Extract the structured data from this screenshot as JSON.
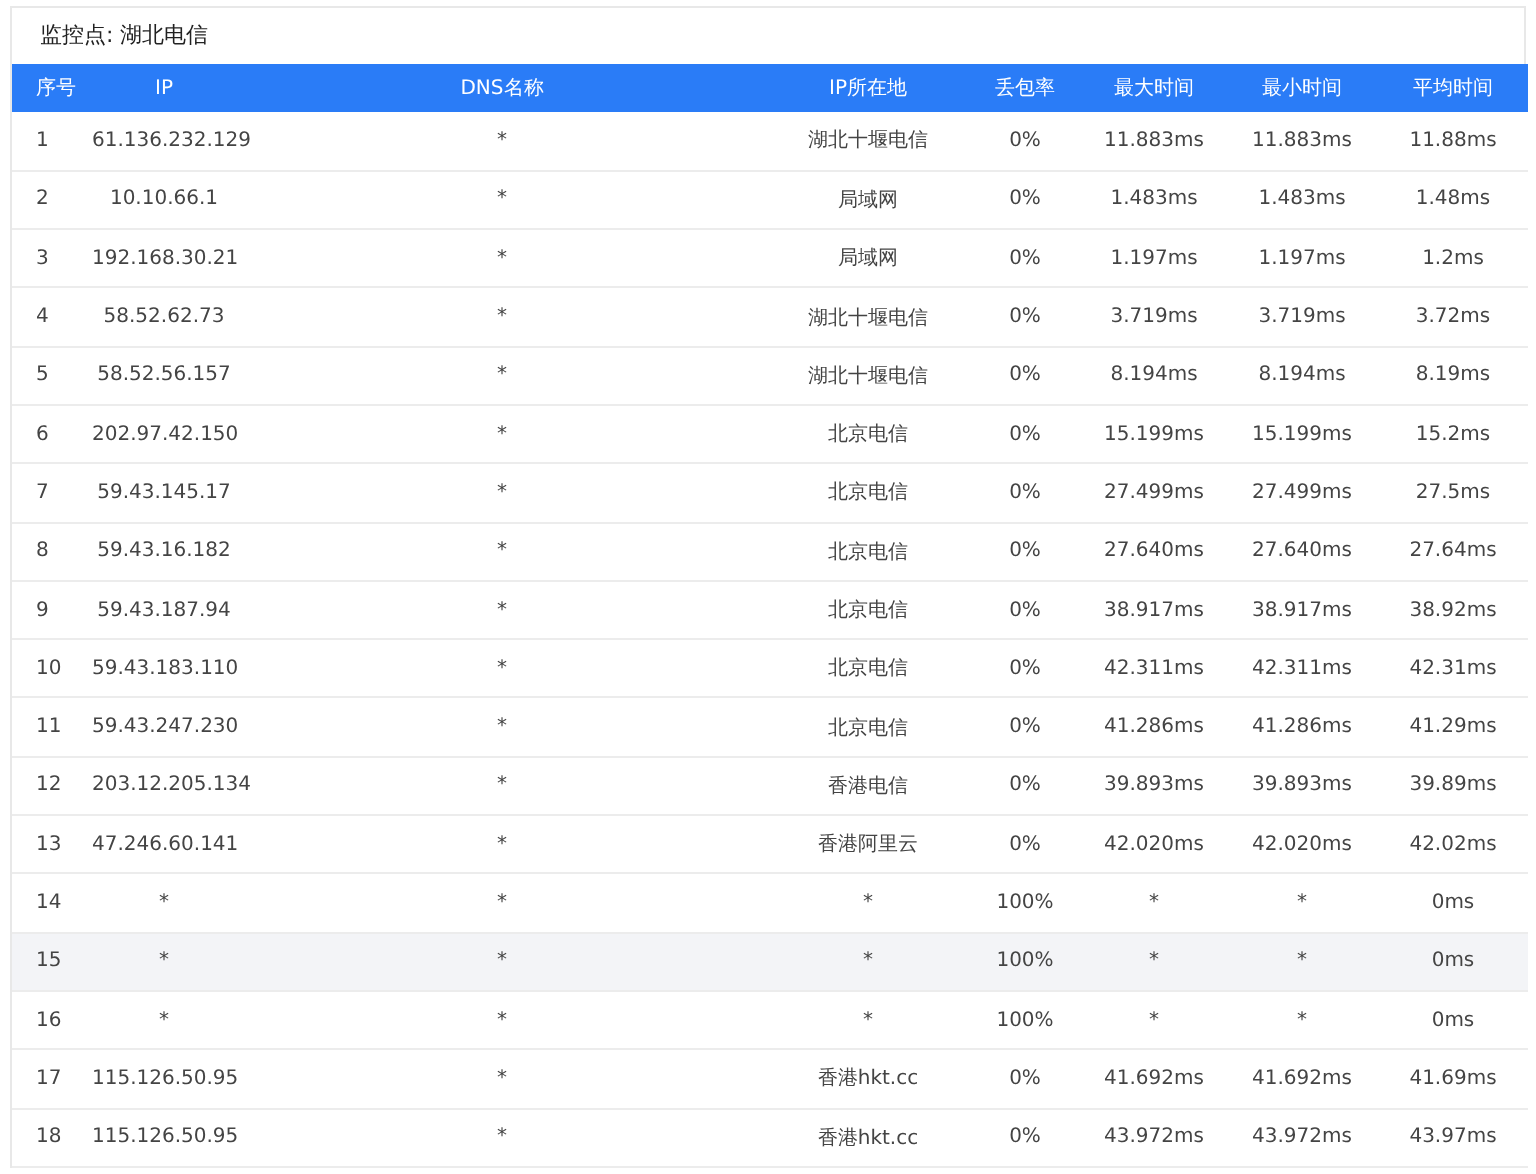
{
  "title": "监控点: 湖北电信",
  "table": {
    "columns": [
      "序号",
      "IP",
      "DNS名称",
      "IP所在地",
      "丢包率",
      "最大时间",
      "最小时间",
      "平均时间"
    ],
    "rows": [
      {
        "cells": [
          "1",
          "61.136.232.129",
          "*",
          "湖北十堰电信",
          "0%",
          "11.883ms",
          "11.883ms",
          "11.88ms"
        ],
        "highlighted": false
      },
      {
        "cells": [
          "2",
          "10.10.66.1",
          "*",
          "局域网",
          "0%",
          "1.483ms",
          "1.483ms",
          "1.48ms"
        ],
        "highlighted": false
      },
      {
        "cells": [
          "3",
          "192.168.30.21",
          "*",
          "局域网",
          "0%",
          "1.197ms",
          "1.197ms",
          "1.2ms"
        ],
        "highlighted": false
      },
      {
        "cells": [
          "4",
          "58.52.62.73",
          "*",
          "湖北十堰电信",
          "0%",
          "3.719ms",
          "3.719ms",
          "3.72ms"
        ],
        "highlighted": false
      },
      {
        "cells": [
          "5",
          "58.52.56.157",
          "*",
          "湖北十堰电信",
          "0%",
          "8.194ms",
          "8.194ms",
          "8.19ms"
        ],
        "highlighted": false
      },
      {
        "cells": [
          "6",
          "202.97.42.150",
          "*",
          "北京电信",
          "0%",
          "15.199ms",
          "15.199ms",
          "15.2ms"
        ],
        "highlighted": false
      },
      {
        "cells": [
          "7",
          "59.43.145.17",
          "*",
          "北京电信",
          "0%",
          "27.499ms",
          "27.499ms",
          "27.5ms"
        ],
        "highlighted": false
      },
      {
        "cells": [
          "8",
          "59.43.16.182",
          "*",
          "北京电信",
          "0%",
          "27.640ms",
          "27.640ms",
          "27.64ms"
        ],
        "highlighted": false
      },
      {
        "cells": [
          "9",
          "59.43.187.94",
          "*",
          "北京电信",
          "0%",
          "38.917ms",
          "38.917ms",
          "38.92ms"
        ],
        "highlighted": false
      },
      {
        "cells": [
          "10",
          "59.43.183.110",
          "*",
          "北京电信",
          "0%",
          "42.311ms",
          "42.311ms",
          "42.31ms"
        ],
        "highlighted": false
      },
      {
        "cells": [
          "11",
          "59.43.247.230",
          "*",
          "北京电信",
          "0%",
          "41.286ms",
          "41.286ms",
          "41.29ms"
        ],
        "highlighted": false
      },
      {
        "cells": [
          "12",
          "203.12.205.134",
          "*",
          "香港电信",
          "0%",
          "39.893ms",
          "39.893ms",
          "39.89ms"
        ],
        "highlighted": false
      },
      {
        "cells": [
          "13",
          "47.246.60.141",
          "*",
          "香港阿里云",
          "0%",
          "42.020ms",
          "42.020ms",
          "42.02ms"
        ],
        "highlighted": false
      },
      {
        "cells": [
          "14",
          "*",
          "*",
          "*",
          "100%",
          "*",
          "*",
          "0ms"
        ],
        "highlighted": false
      },
      {
        "cells": [
          "15",
          "*",
          "*",
          "*",
          "100%",
          "*",
          "*",
          "0ms"
        ],
        "highlighted": true
      },
      {
        "cells": [
          "16",
          "*",
          "*",
          "*",
          "100%",
          "*",
          "*",
          "0ms"
        ],
        "highlighted": false
      },
      {
        "cells": [
          "17",
          "115.126.50.95",
          "*",
          "香港hkt.cc",
          "0%",
          "41.692ms",
          "41.692ms",
          "41.69ms"
        ],
        "highlighted": false
      },
      {
        "cells": [
          "18",
          "115.126.50.95",
          "*",
          "香港hkt.cc",
          "0%",
          "43.972ms",
          "43.972ms",
          "43.97ms"
        ],
        "highlighted": false
      }
    ]
  }
}
